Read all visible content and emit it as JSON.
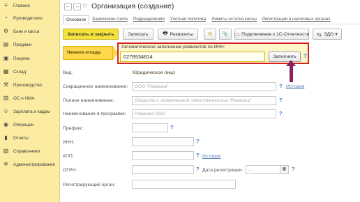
{
  "sidebar": {
    "items": [
      {
        "label": "Главное",
        "icon": "home-icon"
      },
      {
        "label": "Руководителю",
        "icon": "chart-icon"
      },
      {
        "label": "Банк и касса",
        "icon": "bank-icon"
      },
      {
        "label": "Продажи",
        "icon": "cart-icon"
      },
      {
        "label": "Покупки",
        "icon": "basket-icon"
      },
      {
        "label": "Склад",
        "icon": "warehouse-icon"
      },
      {
        "label": "Производство",
        "icon": "factory-icon"
      },
      {
        "label": "ОС и НМА",
        "icon": "assets-icon"
      },
      {
        "label": "Зарплата и кадры",
        "icon": "people-icon"
      },
      {
        "label": "Операции",
        "icon": "operations-icon"
      },
      {
        "label": "Отчеты",
        "icon": "reports-icon"
      },
      {
        "label": "Справочники",
        "icon": "book-icon"
      },
      {
        "label": "Администрирование",
        "icon": "gear-icon"
      }
    ]
  },
  "header": {
    "title": "Организация (создание)",
    "back": "←",
    "forward": "→",
    "star": "☆"
  },
  "tabs": [
    "Основное",
    "Банковские счета",
    "Подразделения",
    "Учетная политика",
    "Лимиты остатка кассы",
    "Регистрации в налоговых органах"
  ],
  "toolbar": {
    "save_close": "Записать и закрыть",
    "save": "Записать",
    "requisites": "Реквизиты",
    "connect": "Подключение к 1С-Отчетности",
    "edo": "ЭДО",
    "dropdown": "▾",
    "mail_glyph": "✉",
    "clip_glyph": "📎",
    "printer_glyph": "🖶",
    "connect_glyph": "▭",
    "edo_glyph": "⇆"
  },
  "hint": {
    "text": "Начните отсюда"
  },
  "autofill": {
    "label": "Автоматическое заполнение реквизитов по ИНН:",
    "value": "0278934814",
    "button": "Заполнить",
    "help": "?"
  },
  "form": {
    "vid_label": "Вид:",
    "vid_value": "Юридическое лицо",
    "short_name_label": "Сокращенное наименование:",
    "short_name_placeholder": "ООО \"Ромашка\"",
    "full_name_label": "Полное наименование:",
    "full_name_placeholder": "Общество с ограниченной ответственностью \"Ромашка\"",
    "program_name_label": "Наименование в программе:",
    "program_name_placeholder": "Ромашка ООО",
    "prefix_label": "Префикс:",
    "inn_label": "ИНН:",
    "kpp_label": "КПП:",
    "ogrn_label": "ОГРН:",
    "reg_date_label": "Дата регистрации:",
    "reg_date_value": " .  .",
    "reg_organ_label": "Регистрирующий орган:",
    "history": "История",
    "help": "?"
  }
}
